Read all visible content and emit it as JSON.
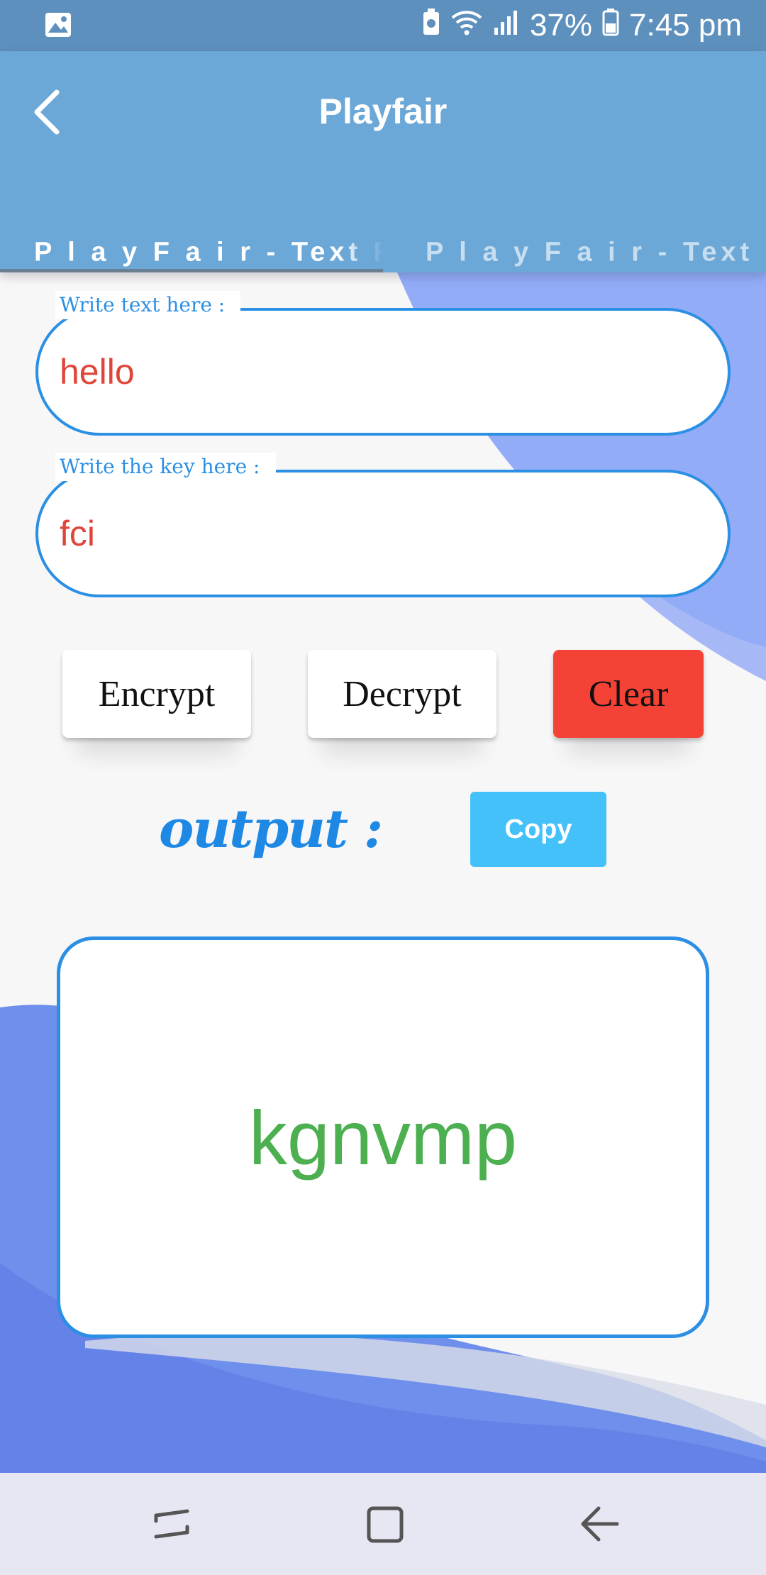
{
  "status_bar": {
    "battery": "37%",
    "time": "7:45 pm",
    "icons": [
      "gallery-icon",
      "battery-saver-icon",
      "wifi-icon",
      "signal-icon",
      "battery-icon"
    ]
  },
  "app_bar": {
    "title": "Playfair",
    "back_icon": "arrow-left-icon"
  },
  "tabs": [
    {
      "label": "P l a y F a i r - Text Form",
      "active": true
    },
    {
      "label": "P l a y F a i r - Text File",
      "active": false
    }
  ],
  "text_field": {
    "label": "Write text here :",
    "value": "hello"
  },
  "key_field": {
    "label": "Write the key here :",
    "value": "fci"
  },
  "buttons": {
    "encrypt": "Encrypt",
    "decrypt": "Decrypt",
    "clear": "Clear"
  },
  "output": {
    "label": "output :",
    "copy": "Copy",
    "value": "kgnvmp"
  },
  "colors": {
    "app_bar": "#6ca8d7",
    "status_bar": "#5e90bd",
    "accent_blue": "#2b8fe3",
    "input_text": "#e0453a",
    "clear_button": "#f44336",
    "copy_button": "#44c1f9",
    "output_text": "#4caf50"
  },
  "nav_bar": {
    "icons": [
      "recent-apps-icon",
      "home-icon",
      "back-icon"
    ]
  }
}
